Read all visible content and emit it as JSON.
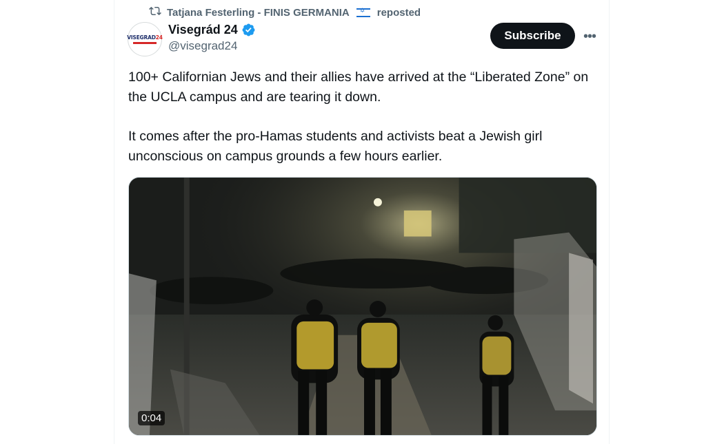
{
  "repost": {
    "reposter": "Tatjana Festerling - FINIS GERMANIA",
    "label": "reposted",
    "flag_icon": "israel-flag-icon"
  },
  "author": {
    "name": "Visegrád 24",
    "handle": "@visegrad24",
    "verified": true,
    "avatar_logo": {
      "main": "VISEGRAD",
      "accent": "24"
    },
    "verified_color": "#1d9bf0"
  },
  "actions": {
    "subscribe_label": "Subscribe",
    "more_label": "•••"
  },
  "tweet": {
    "paragraphs": [
      "100+ Californian Jews and their allies have arrived at the “Liberated Zone” on the UCLA campus and are tearing it down.",
      "It comes after the pro-Hamas students and activists beat a Jewish girl unconscious on campus grounds a few hours earlier."
    ]
  },
  "media": {
    "type": "video",
    "duration": "0:04"
  },
  "colors": {
    "text": "#0f1419",
    "secondary": "#536471",
    "button_bg": "#0f1419"
  }
}
